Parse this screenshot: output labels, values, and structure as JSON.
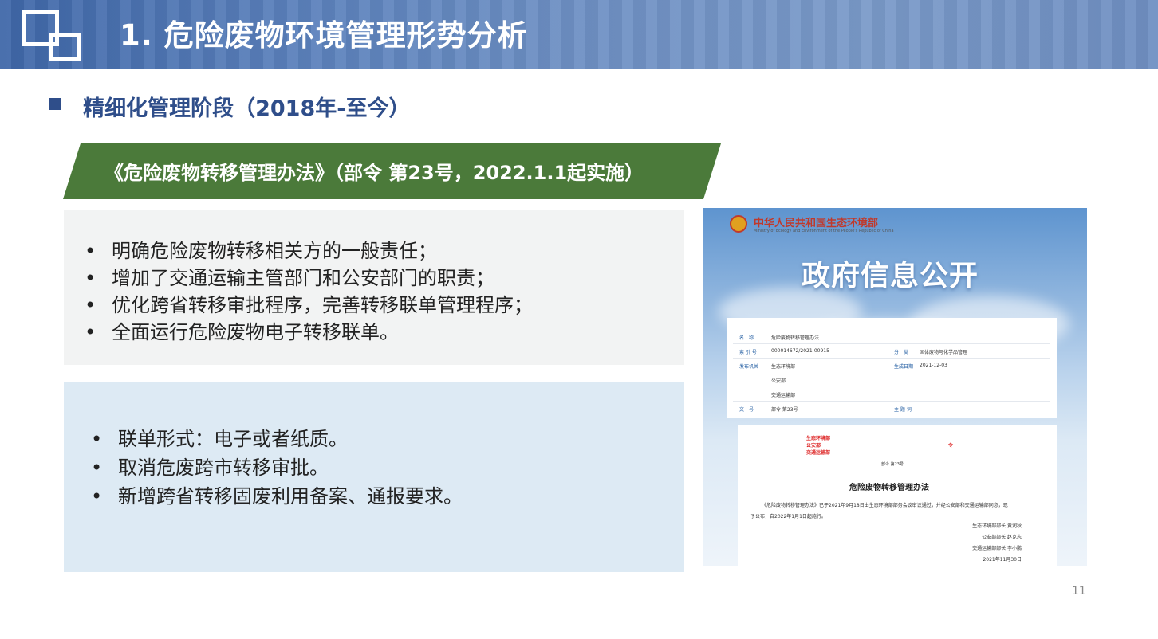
{
  "header": {
    "title": "1. 危险废物环境管理形势分析"
  },
  "section": {
    "title": "精细化管理阶段（2018年-至今）"
  },
  "banner": {
    "text": "《危险废物转移管理办法》（部令 第23号，2022.1.1起实施）"
  },
  "box1": {
    "items": [
      "明确危险废物转移相关方的一般责任；",
      "增加了交通运输主管部门和公安部门的职责；",
      "优化跨省转移审批程序，完善转移联单管理程序；",
      "全面运行危险废物电子转移联单。"
    ]
  },
  "box2": {
    "items": [
      "联单形式：电子或者纸质。",
      "取消危废跨市转移审批。",
      "新增跨省转移固废利用备案、通报要求。"
    ]
  },
  "bullet_char": "•",
  "doc": {
    "ministry": "中华人民共和国生态环境部",
    "ministry_en": "Ministry of Ecology and Environment of the People's Republic of China",
    "gov_title": "政府信息公开",
    "info": {
      "name_label": "名　称",
      "name_value": "危险废物转移管理办法",
      "index_label": "索 引 号",
      "index_value": "000014672/2021-00915",
      "category_label": "分　类",
      "category_value": "固体废物与化学品管理",
      "issuer_label": "发布机关",
      "issuer_values": [
        "生态环境部",
        "公安部",
        "交通运输部"
      ],
      "date_label": "生成日期",
      "date_value": "2021-12-03",
      "doc_no_label": "文　号",
      "doc_no_value": "部令 第23号",
      "topic_label": "主 题 词",
      "topic_value": ""
    },
    "header_red": [
      "生态环境部",
      "公安部",
      "交通运输部"
    ],
    "red_ling": "令",
    "order_no": "部令 第23号",
    "doc_title": "危险废物转移管理办法",
    "para1": "《危险废物转移管理办法》已于2021年9月18日由生态环境部部务会议审议通过，并经公安部和交通运输部同意，现",
    "para2": "予公布，自2022年1月1日起施行。",
    "signatures": [
      "生态环境部部长 黄润秋",
      "公安部部长 赵克志",
      "交通运输部部长 李小鹏",
      "2021年11月30日"
    ]
  },
  "page_number": "11",
  "colors": {
    "accent_blue": "#2f4e8a",
    "banner_green": "#4b7a3a",
    "header_blue": "#5a80bb"
  }
}
